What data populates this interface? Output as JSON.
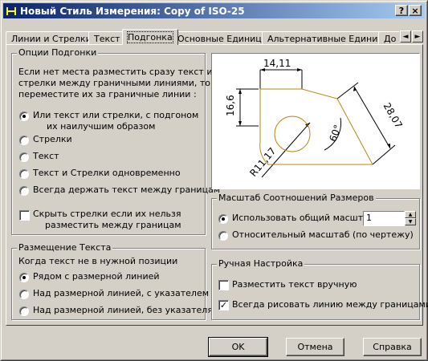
{
  "window": {
    "title": "Новый Стиль Измерения: Copy of ISO-25",
    "help_btn": "?",
    "close_btn": "×"
  },
  "tabs": [
    {
      "label": "Линии и Стрелки"
    },
    {
      "label": "Текст"
    },
    {
      "label": "Подгонка"
    },
    {
      "label": "Основные Единицы"
    },
    {
      "label": "Альтернативные Единицы"
    },
    {
      "label": "До"
    }
  ],
  "tab_scroll": {
    "left": "◄",
    "right": "►"
  },
  "fit_options": {
    "legend": "Опции Подгонки",
    "description": [
      "Если нет места разместить сразу текст и",
      "стрелки между граничными линиями, тогда",
      "переместите их за граничные линии :"
    ],
    "radios": [
      {
        "label1": "Или текст или стрелки, с подгоном",
        "label2": "их наилучшим образом",
        "checked": true
      },
      {
        "label1": "Стрелки",
        "checked": false
      },
      {
        "label1": "Текст",
        "checked": false
      },
      {
        "label1": "Текст и Стрелки одновременно",
        "checked": false
      },
      {
        "label1": "Всегда держать текст между границам",
        "checked": false
      }
    ],
    "suppress_checkbox": {
      "label1": "Скрыть стрелки если их нельзя",
      "label2": "разместить между границам",
      "checked": false
    }
  },
  "text_placement": {
    "legend": "Размещение Текста",
    "caption": "Когда текст не в нужной позиции",
    "radios": [
      {
        "label": "Рядом с размерной линией",
        "checked": true
      },
      {
        "label": "Над размерной линией, с указателем",
        "checked": false
      },
      {
        "label": "Над размерной линией, без указателя",
        "checked": false
      }
    ]
  },
  "preview": {
    "dim_top": "14,11",
    "dim_left": "16,6",
    "dim_right": "28,07",
    "dim_angle": "60°",
    "dim_radius": "R11,17"
  },
  "scale": {
    "legend": "Масштаб Соотношений Размеров",
    "overall_label": "Использовать общий масштаб:",
    "overall_value": "1",
    "layout_label": "Относительный масштаб (по чертежу)",
    "overall_checked": true
  },
  "fine_tuning": {
    "legend": "Ручная Настройка",
    "manual_label": "Разместить текст вручную",
    "manual_checked": false,
    "always_label": "Всегда рисовать линию между границами",
    "always_checked": true,
    "check_mark": "✓"
  },
  "buttons": {
    "ok": "OK",
    "cancel": "Отмена",
    "help": "Справка"
  }
}
